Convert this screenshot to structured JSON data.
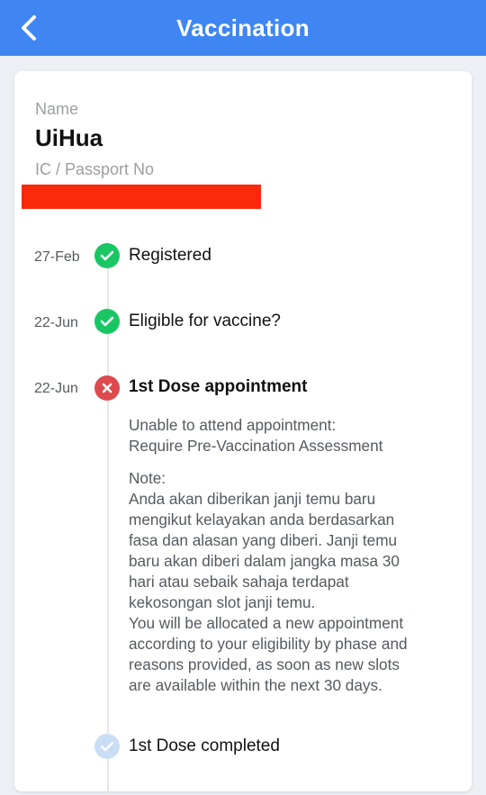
{
  "header": {
    "title": "Vaccination",
    "back_icon": "chevron-left-icon",
    "background": "#3f86f3"
  },
  "profile": {
    "name_label": "Name",
    "name_value": "UiHua",
    "id_label": "IC / Passport No"
  },
  "timeline": [
    {
      "date": "27-Feb",
      "label": "Registered",
      "status": "done",
      "icon": "check-icon"
    },
    {
      "date": "22-Jun",
      "label": "Eligible for vaccine?",
      "status": "done",
      "icon": "check-icon"
    },
    {
      "date": "22-Jun",
      "label": "1st Dose appointment",
      "status": "failed",
      "icon": "cross-icon"
    },
    {
      "date": "",
      "label": "1st Dose completed",
      "status": "pending",
      "icon": "check-icon"
    }
  ],
  "appointment_detail": {
    "reason": "Unable to attend appointment:\nRequire Pre-Vaccination Assessment",
    "note": "Note:\nAnda akan diberikan janji temu baru\nmengikut kelayakan anda berdasarkan\nfasa dan alasan yang diberi. Janji temu\nbaru akan diberi dalam jangka masa 30\nhari atau sebaik sahaja terdapat\nkekosongan slot janji temu.\nYou will be allocated a new appointment\naccording to your eligibility by phase and\nreasons provided, as soon as new slots\nare available within the next 30 days."
  },
  "colors": {
    "done": "#1ac664",
    "failed": "#dd4b4e",
    "pending": "#c9ddf5",
    "redaction": "#fb2a0d"
  }
}
